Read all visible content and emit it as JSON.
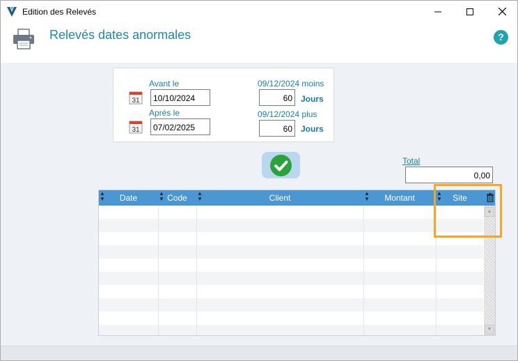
{
  "window": {
    "title": "Edition des Relevés",
    "controls": {
      "minimize": "—",
      "maximize": "☐",
      "close": "✕"
    }
  },
  "header": {
    "title": "Relevés dates anormales",
    "help_label": "?"
  },
  "filters": {
    "avant_label": "Avant le",
    "avant_value": "10/10/2024",
    "apres_label": "Aprés le",
    "apres_value": "07/02/2025",
    "moins_label": "09/12/2024 moins",
    "moins_value": "60",
    "plus_label": "09/12/2024 plus",
    "plus_value": "60",
    "unit_label": "Jours",
    "calendar_day": "31"
  },
  "total": {
    "label": "Total",
    "value": "0,00"
  },
  "table": {
    "columns": [
      {
        "label": "Date"
      },
      {
        "label": "Code"
      },
      {
        "label": "Client"
      },
      {
        "label": "Montant"
      },
      {
        "label": "Site"
      }
    ],
    "rows": []
  },
  "colors": {
    "accent": "#1b89b4",
    "header_bg": "#4a97d3",
    "ok_green": "#2aa33a",
    "highlight": "#f5a623"
  }
}
